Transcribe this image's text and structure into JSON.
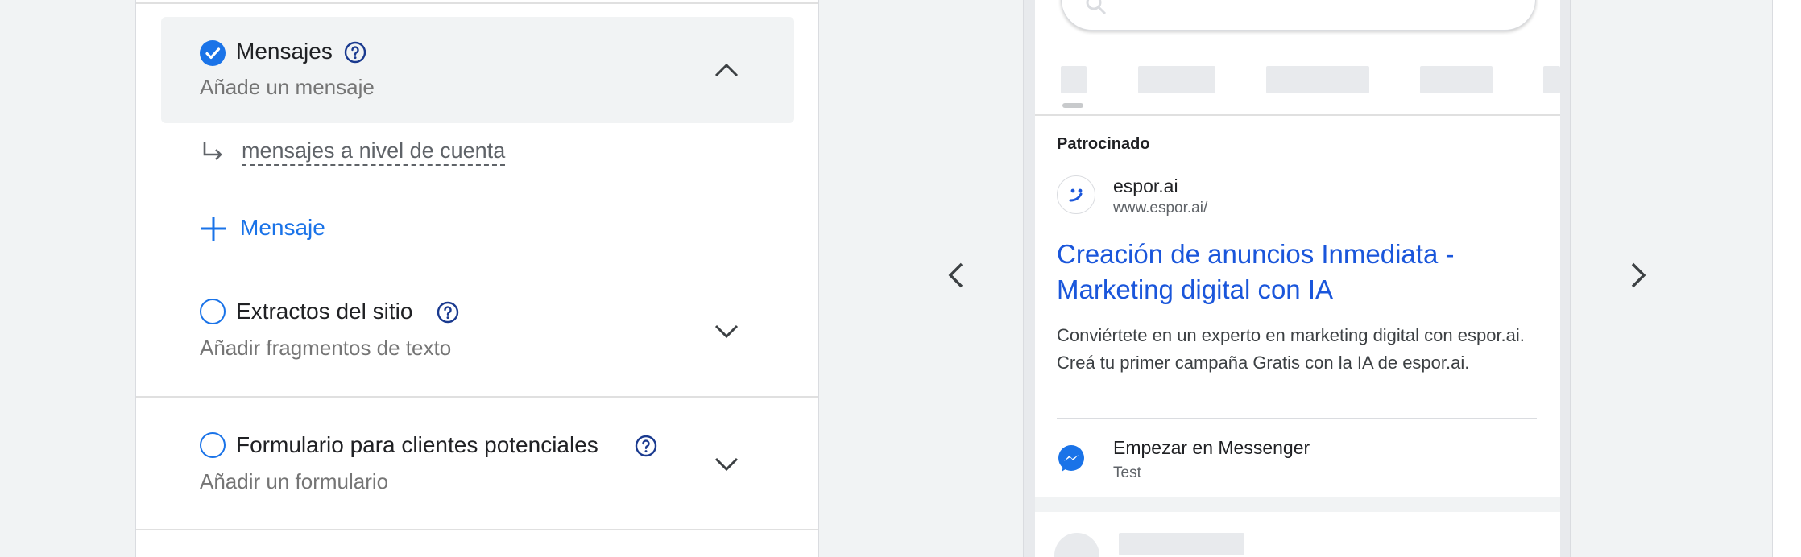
{
  "sections": [
    {
      "id": "messages",
      "title": "Mensajes",
      "subtitle": "Añade un mensaje",
      "checked": true,
      "expanded": true
    },
    {
      "id": "sitelinks",
      "title": "Extractos del sitio",
      "subtitle": "Añadir fragmentos de texto",
      "checked": false,
      "expanded": false
    },
    {
      "id": "lead-form",
      "title": "Formulario para clientes potenciales",
      "subtitle": "Añadir un formulario",
      "checked": false,
      "expanded": false
    }
  ],
  "messages_panel": {
    "account_level_link": "mensajes a nivel de cuenta",
    "add_message_label": "Mensaje"
  },
  "preview": {
    "sponsored_label": "Patrocinado",
    "site_name": "espor.ai",
    "site_url": "www.espor.ai/",
    "headline": "Creación de anuncios Inmediata - Marketing digital con IA",
    "description": "Conviértete en un experto en marketing digital con espor.ai. Creá tu primer campaña Gratis con la IA de espor.ai.",
    "cta_label": "Empezar en Messenger",
    "cta_sub": "Test"
  },
  "colors": {
    "accent": "#1a73e8",
    "headline": "#1a56db",
    "active_bg": "#f1f3f4"
  }
}
